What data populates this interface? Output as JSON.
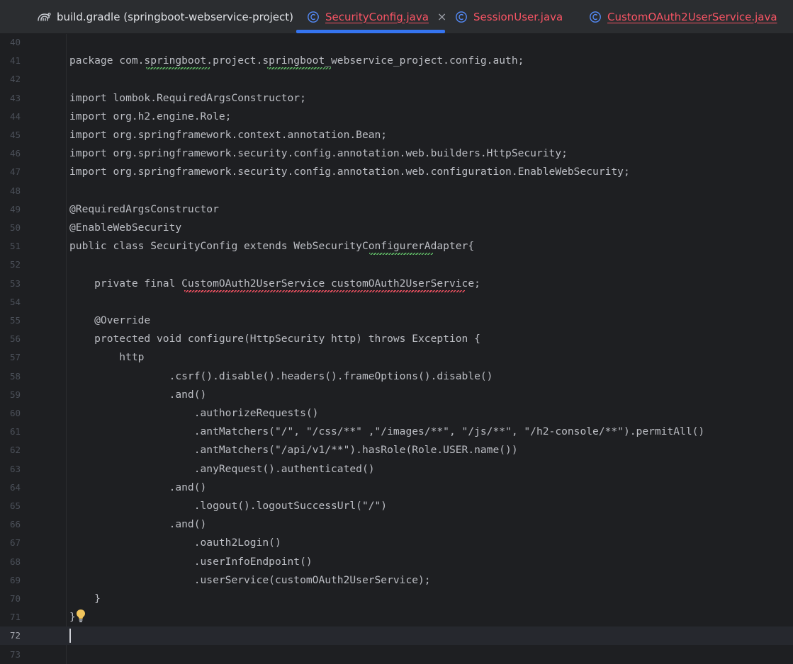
{
  "tabs": [
    {
      "label": "build.gradle (springboot-webservice-project)",
      "icon": "gradle-icon",
      "active": false,
      "error": false
    },
    {
      "label": "SecurityConfig.java",
      "icon": "java-class-icon",
      "active": true,
      "error": true,
      "close": "×"
    },
    {
      "label": "SessionUser.java",
      "icon": "java-class-icon",
      "active": false,
      "error": false
    },
    {
      "label": "CustomOAuth2UserService.java",
      "icon": "java-class-icon",
      "active": false,
      "error": true
    }
  ],
  "colors": {
    "background": "#1e1f22",
    "tab_bar": "#2b2d30",
    "active_underline": "#3574f0",
    "error_red": "#f75464",
    "code_text": "#bcbec4",
    "warning_squiggle": "#5fb865",
    "lightbulb": "#f2c55c"
  },
  "editor": {
    "current_line": "72",
    "lines": [
      {
        "n": "40",
        "text": ""
      },
      {
        "n": "41",
        "text": "package com.springboot.project.springboot_webservice_project.config.auth;"
      },
      {
        "n": "42",
        "text": ""
      },
      {
        "n": "43",
        "text": "import lombok.RequiredArgsConstructor;"
      },
      {
        "n": "44",
        "text": "import org.h2.engine.Role;"
      },
      {
        "n": "45",
        "text": "import org.springframework.context.annotation.Bean;"
      },
      {
        "n": "46",
        "text": "import org.springframework.security.config.annotation.web.builders.HttpSecurity;"
      },
      {
        "n": "47",
        "text": "import org.springframework.security.config.annotation.web.configuration.EnableWebSecurity;"
      },
      {
        "n": "48",
        "text": ""
      },
      {
        "n": "49",
        "text": "@RequiredArgsConstructor"
      },
      {
        "n": "50",
        "text": "@EnableWebSecurity"
      },
      {
        "n": "51",
        "text": "public class SecurityConfig extends WebSecurityConfigurerAdapter{"
      },
      {
        "n": "52",
        "text": ""
      },
      {
        "n": "53",
        "text": "    private final CustomOAuth2UserService customOAuth2UserService;"
      },
      {
        "n": "54",
        "text": ""
      },
      {
        "n": "55",
        "text": "    @Override"
      },
      {
        "n": "56",
        "text": "    protected void configure(HttpSecurity http) throws Exception {"
      },
      {
        "n": "57",
        "text": "        http"
      },
      {
        "n": "58",
        "text": "                .csrf().disable().headers().frameOptions().disable()"
      },
      {
        "n": "59",
        "text": "                .and()"
      },
      {
        "n": "60",
        "text": "                    .authorizeRequests()"
      },
      {
        "n": "61",
        "text": "                    .antMatchers(\"/\", \"/css/**\" ,\"/images/**\", \"/js/**\", \"/h2-console/**\").permitAll()"
      },
      {
        "n": "62",
        "text": "                    .antMatchers(\"/api/v1/**\").hasRole(Role.USER.name())"
      },
      {
        "n": "63",
        "text": "                    .anyRequest().authenticated()"
      },
      {
        "n": "64",
        "text": "                .and()"
      },
      {
        "n": "65",
        "text": "                    .logout().logoutSuccessUrl(\"/\")"
      },
      {
        "n": "66",
        "text": "                .and()"
      },
      {
        "n": "67",
        "text": "                    .oauth2Login()"
      },
      {
        "n": "68",
        "text": "                    .userInfoEndpoint()"
      },
      {
        "n": "69",
        "text": "                    .userService(customOAuth2UserService);"
      },
      {
        "n": "70",
        "text": "    }"
      },
      {
        "n": "71",
        "text": "}"
      },
      {
        "n": "72",
        "text": ""
      },
      {
        "n": "73",
        "text": ""
      }
    ]
  }
}
